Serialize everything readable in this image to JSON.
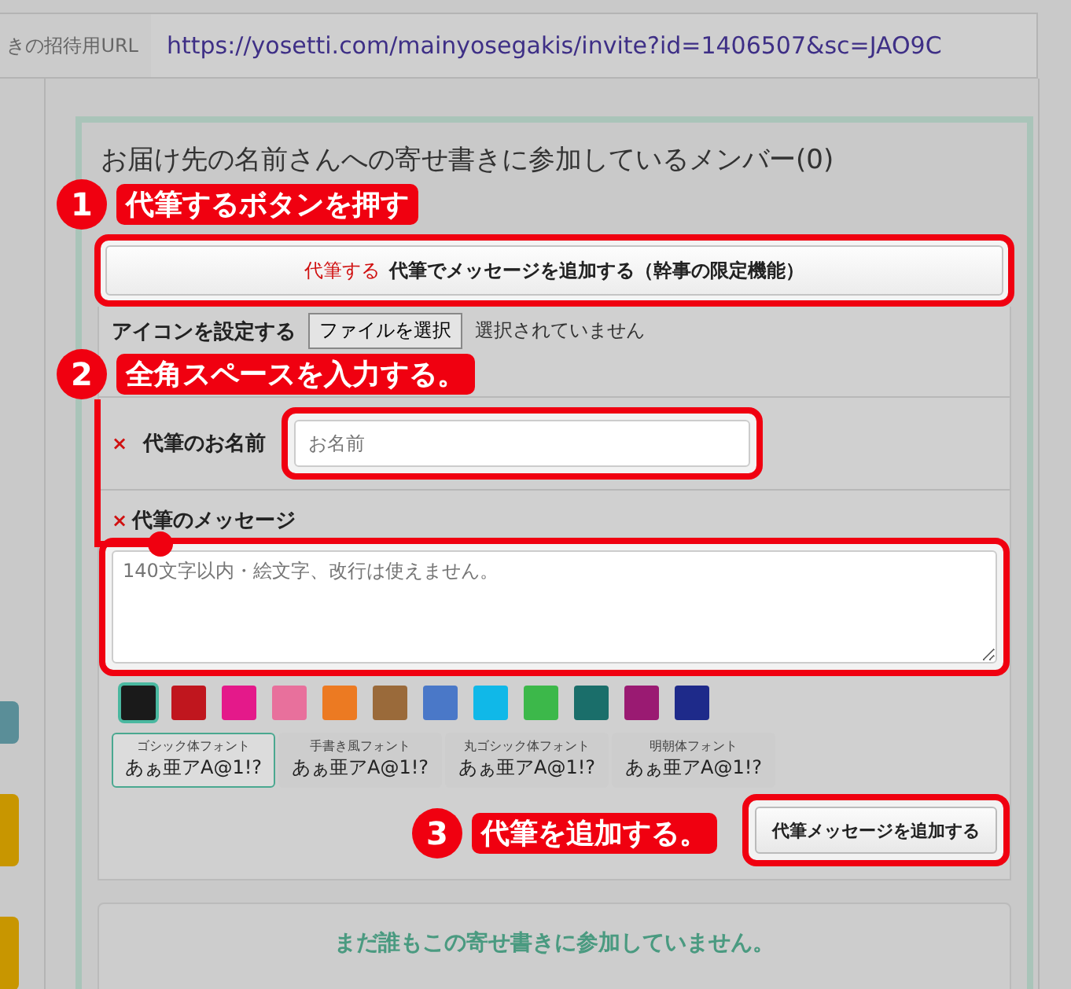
{
  "url_bar": {
    "label": "きの招待用URL",
    "url": "https://yosetti.com/mainyosegakis/invite?id=1406507&sc=JAO9C"
  },
  "members_title": "お届け先の名前さんへの寄せ書きに参加しているメンバー(0)",
  "proxy_button": {
    "tag": "代筆する",
    "label": "代筆でメッセージを追加する（幹事の限定機能）"
  },
  "icon_row": {
    "label": "アイコンを設定する",
    "file_button": "ファイルを選択",
    "file_status": "選択されていません"
  },
  "name_field": {
    "required_mark": "×",
    "label": "代筆のお名前",
    "placeholder": "お名前"
  },
  "message_field": {
    "required_mark": "×",
    "label": "代筆のメッセージ",
    "placeholder": "140文字以内・絵文字、改行は使えません。"
  },
  "colors": [
    {
      "color": "#1a1a1a",
      "selected": true
    },
    {
      "color": "#c0161e",
      "selected": false
    },
    {
      "color": "#e4198a",
      "selected": false
    },
    {
      "color": "#e8709c",
      "selected": false
    },
    {
      "color": "#ec7a22",
      "selected": false
    },
    {
      "color": "#9a6a3a",
      "selected": false
    },
    {
      "color": "#4a78c8",
      "selected": false
    },
    {
      "color": "#10b8e8",
      "selected": false
    },
    {
      "color": "#3cb84a",
      "selected": false
    },
    {
      "color": "#1a6e6a",
      "selected": false
    },
    {
      "color": "#9a1a72",
      "selected": false
    },
    {
      "color": "#1e2a8a",
      "selected": false
    }
  ],
  "fonts": [
    {
      "name": "ゴシック体フォント",
      "sample": "あぁ亜アA@1!?",
      "selected": true
    },
    {
      "name": "手書き風フォント",
      "sample": "あぁ亜アA@1!?",
      "selected": false
    },
    {
      "name": "丸ゴシック体フォント",
      "sample": "あぁ亜アA@1!?",
      "selected": false
    },
    {
      "name": "明朝体フォント",
      "sample": "あぁ亜アA@1!?",
      "selected": false
    }
  ],
  "side_tabs": [
    {
      "color": "#5a8e98"
    },
    {
      "color": "#c89600"
    },
    {
      "color": "#c89600"
    }
  ],
  "submit_button": "代筆メッセージを追加する",
  "empty_message": "まだ誰もこの寄せ書きに参加していません。",
  "callouts": [
    {
      "number": "1",
      "text": "代筆するボタンを押す"
    },
    {
      "number": "2",
      "text": "全角スペースを入力する。"
    },
    {
      "number": "3",
      "text": "代筆を追加する。"
    }
  ]
}
